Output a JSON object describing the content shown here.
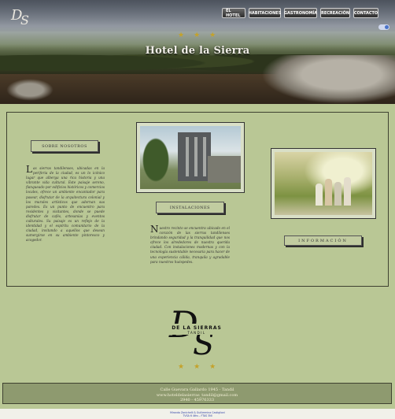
{
  "header": {
    "title": "Hotel de la Sierra",
    "logo_monogram": "DS",
    "stars": [
      "★",
      "★",
      "★"
    ]
  },
  "nav": {
    "items": [
      {
        "label": "EL HOTEL"
      },
      {
        "label": "HABITACIONES"
      },
      {
        "label": "GASTRONOMÍA"
      },
      {
        "label": "RECREACIÓN"
      },
      {
        "label": "CONTACTO"
      }
    ]
  },
  "sections": {
    "about": {
      "button_label": "SOBRE NOSOTROS",
      "drop_cap": "L",
      "text": "as sierras tandilenses, ubicadas en la periferia de la ciudad, es un lo icónico lugar que alberga una rica historia y una vibrante vida cultural. Este paisaje sereno, flanqueado por edificios históricos y comercios locales, ofrece un ambiente encantador para pasear, disfrutar de la arquitectura colonial y los murales artísticos que adornan sus paredes. Es un punto de encuentro para residentes y visitantes, donde se puede disfrutar de cafés, artesanías y eventos culturales. Su paisaje es un reflejo de la identidad y el espíritu comunitario de la ciudad, invitando a aquellos que desean sumergirse en su ambiente pintoresco y acogedor."
    },
    "facilities": {
      "button_label": "INSTALACIONES",
      "drop_cap": "N",
      "text": "uestro recinto se encuentra ubicado en el corazón de las sierras tandilenses brindando seguridad y la tranquilidad que nos ofrece los alrededores de nuestra querida ciudad. Con instalaciones modernas y con la tecnología sustentable necesaria para hacer de una experiencia cálida, tranquila y agradable para nuestros huéspedes."
    },
    "info": {
      "button_label": "INFORMACIÓN"
    }
  },
  "footer": {
    "address": "Calle Guevara Gallardo 1945 - Tandil",
    "email": "www.hoteldelasierras_tandil@gmail.com",
    "phone": "2940 - 45976333",
    "logo_text": "DE LA SIERRAS",
    "logo_subtext": "TANDIL",
    "copyright_line1": "Miranda Zanichelli & Guillermina Castiglioni",
    "copyright_line2": "TVSA 6 4ths – FTAS 3NI"
  },
  "colors": {
    "page_bg": "#b9c795",
    "footer_bg": "#8e9a6f",
    "star": "#c4a22a",
    "nav_bg": "#3a3a3a"
  }
}
